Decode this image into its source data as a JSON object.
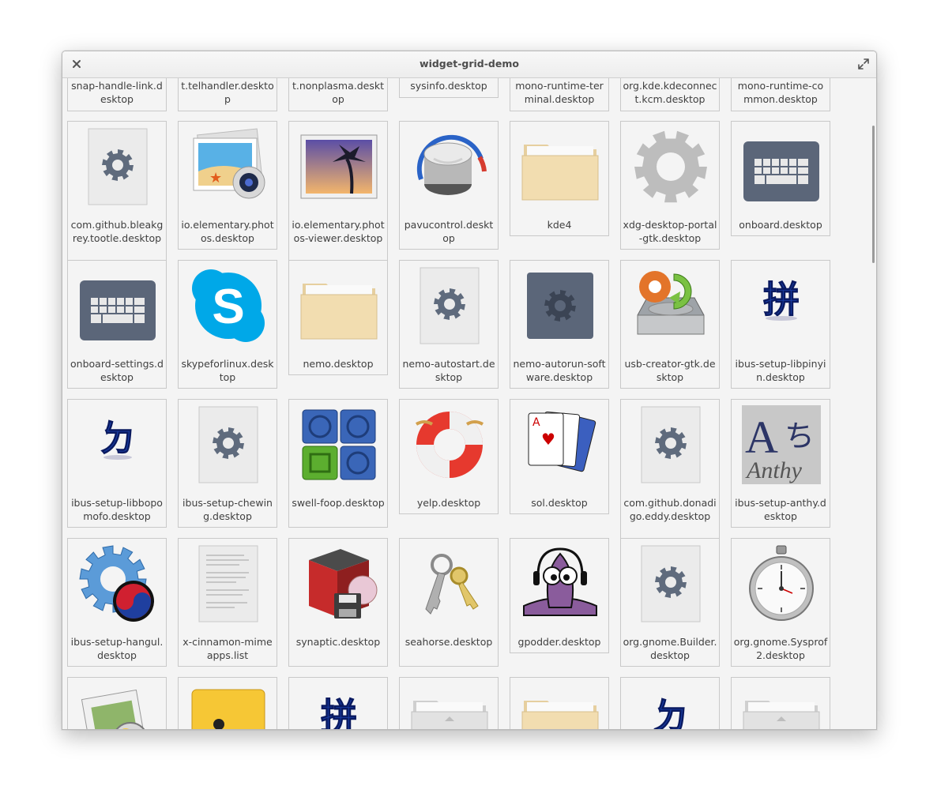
{
  "window": {
    "title": "widget-grid-demo"
  },
  "rows": [
    {
      "type": "partial",
      "tiles": [
        {
          "label": "snap-handle-link.desktop"
        },
        {
          "label": "org.kde.kdeconnect.telhandler.desktop"
        },
        {
          "label": "org.kde.kdeconnect.nonplasma.desktop"
        },
        {
          "label": "sysinfo.desktop"
        },
        {
          "label": "mono-runtime-terminal.desktop"
        },
        {
          "label": "org.kde.kdeconnect.kcm.desktop"
        },
        {
          "label": "mono-runtime-common.desktop"
        }
      ]
    },
    {
      "type": "full",
      "tiles": [
        {
          "label": "com.github.bleakgrey.tootle.desktop",
          "icon": "settings-doc-icon"
        },
        {
          "label": "io.elementary.photos.desktop",
          "icon": "photos-icon"
        },
        {
          "label": "io.elementary.photos-viewer.desktop",
          "icon": "photo-viewer-icon"
        },
        {
          "label": "pavucontrol.desktop",
          "icon": "volume-knob-icon"
        },
        {
          "label": "kde4",
          "icon": "folder-icon"
        },
        {
          "label": "xdg-desktop-portal-gtk.desktop",
          "icon": "gear-icon"
        },
        {
          "label": "onboard.desktop",
          "icon": "keyboard-icon"
        }
      ]
    },
    {
      "type": "full",
      "tiles": [
        {
          "label": "onboard-settings.desktop",
          "icon": "keyboard-icon"
        },
        {
          "label": "skypeforlinux.desktop",
          "icon": "skype-icon"
        },
        {
          "label": "nemo.desktop",
          "icon": "folder-icon"
        },
        {
          "label": "nemo-autostart.desktop",
          "icon": "settings-doc-icon"
        },
        {
          "label": "nemo-autorun-software.desktop",
          "icon": "settings-dark-icon"
        },
        {
          "label": "usb-creator-gtk.desktop",
          "icon": "usb-creator-icon"
        },
        {
          "label": "ibus-setup-libpinyin.desktop",
          "icon": "pinyin-icon"
        }
      ]
    },
    {
      "type": "full",
      "tiles": [
        {
          "label": "ibus-setup-libbopomofo.desktop",
          "icon": "bopomofo-icon"
        },
        {
          "label": "ibus-setup-chewing.desktop",
          "icon": "settings-doc-icon"
        },
        {
          "label": "swell-foop.desktop",
          "icon": "swell-foop-icon"
        },
        {
          "label": "yelp.desktop",
          "icon": "lifebuoy-icon"
        },
        {
          "label": "sol.desktop",
          "icon": "cards-icon"
        },
        {
          "label": "com.github.donadigo.eddy.desktop",
          "icon": "settings-doc-icon"
        },
        {
          "label": "ibus-setup-anthy.desktop",
          "icon": "anthy-icon"
        }
      ]
    },
    {
      "type": "full",
      "tiles": [
        {
          "label": "ibus-setup-hangul.desktop",
          "icon": "hangul-gear-icon"
        },
        {
          "label": "x-cinnamon-mimeapps.list",
          "icon": "text-doc-icon"
        },
        {
          "label": "synaptic.desktop",
          "icon": "synaptic-icon"
        },
        {
          "label": "seahorse.desktop",
          "icon": "keys-icon"
        },
        {
          "label": "gpodder.desktop",
          "icon": "gpodder-icon"
        },
        {
          "label": "org.gnome.Builder.desktop",
          "icon": "settings-doc-icon"
        },
        {
          "label": "org.gnome.Sysprof2.desktop",
          "icon": "stopwatch-icon"
        }
      ]
    },
    {
      "type": "bottom",
      "tiles": [
        {
          "icon": "image-viewer-icon"
        },
        {
          "icon": "parental-icon"
        },
        {
          "icon": "pinyin-icon"
        },
        {
          "icon": "folder-grey-icon"
        },
        {
          "icon": "folder-icon"
        },
        {
          "icon": "bopomofo-icon"
        },
        {
          "icon": "folder-grey-icon"
        }
      ]
    }
  ]
}
